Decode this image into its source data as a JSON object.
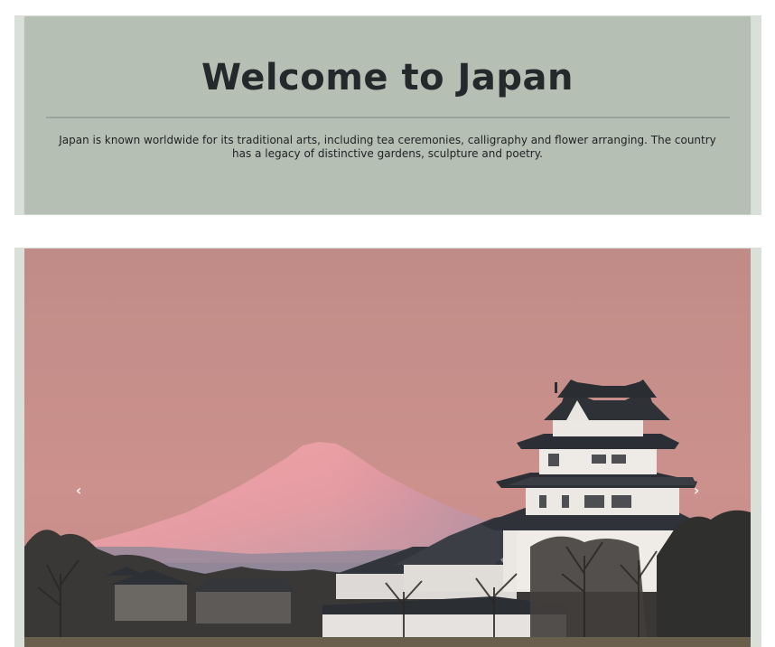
{
  "hero": {
    "title": "Welcome to Japan",
    "description": "Japan is known worldwide for its traditional arts, including tea ceremonies, calligraphy and flower arranging. The country has a legacy of distinctive gardens, sculpture and poetry."
  },
  "carousel": {
    "prev_icon": "chevron-left-icon",
    "next_icon": "chevron-right-icon",
    "prev_glyph": "‹",
    "next_glyph": "›",
    "slide": {
      "subject": "Mount Fuji and Japanese castle at sunset"
    }
  },
  "colors": {
    "hero_background": "#b5bfb4",
    "frame_background": "#d9e0d9",
    "sky": "#c88f8b",
    "title_text": "#24292b"
  }
}
